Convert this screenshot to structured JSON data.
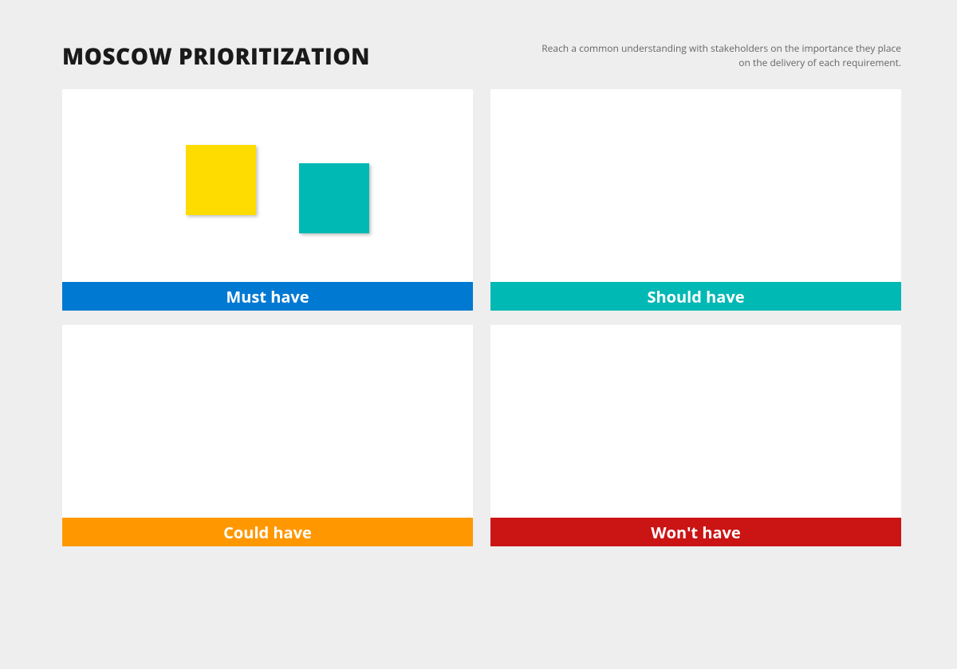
{
  "header": {
    "title": "MOSCOW PRIORITIZATION",
    "subtitle": "Reach a common understanding with stakeholders on the importance they place on the delivery of each requirement."
  },
  "quadrants": {
    "must": {
      "label": "Must have"
    },
    "should": {
      "label": "Should have"
    },
    "could": {
      "label": "Could have"
    },
    "wont": {
      "label": "Won't have"
    }
  },
  "stickies": {
    "must": [
      {
        "color": "#ffdc00",
        "name": "yellow"
      },
      {
        "color": "#00b8b4",
        "name": "teal"
      }
    ]
  }
}
